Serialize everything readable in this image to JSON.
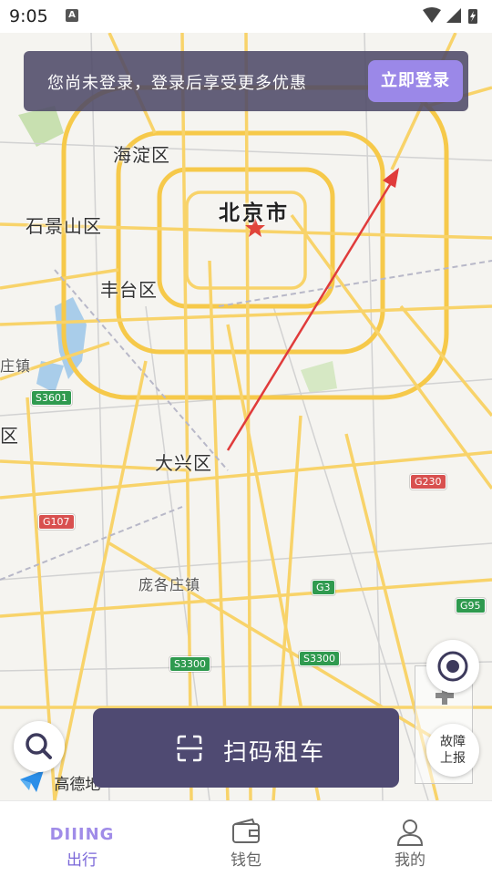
{
  "status_bar": {
    "time": "9:05",
    "notification_icon": "A"
  },
  "map": {
    "labels": {
      "haidian": "海淀区",
      "beijing": "北京市",
      "shijingshan": "石景山区",
      "fengtai": "丰台区",
      "daxing": "大兴区",
      "pangezhuang": "庞各庄镇",
      "zhen_partial": "庄镇",
      "qu_partial": "区"
    },
    "road_shields": {
      "s3601": "S3601",
      "g107": "G107",
      "g230": "G230",
      "g3": "G3",
      "g95": "G95",
      "s3300_a": "S3300",
      "s3300_b": "S3300"
    },
    "attribution": "高德地"
  },
  "login_banner": {
    "text": "您尚未登录，登录后享受更多优惠",
    "button_label": "立即登录"
  },
  "floating": {
    "report_line1": "故障",
    "report_line2": "上报"
  },
  "scan_button": {
    "label": "扫码租车"
  },
  "tab_bar": {
    "items": [
      {
        "label": "出行",
        "logo_text": "DIIING",
        "active": true
      },
      {
        "label": "钱包",
        "active": false
      },
      {
        "label": "我的",
        "active": false
      }
    ]
  },
  "colors": {
    "accent": "#7a67d8",
    "scan_bg": "#4f4a72",
    "banner_bg": "#4e4a68",
    "road_yellow": "#f6c94a",
    "arrow_red": "#e03b3b"
  }
}
